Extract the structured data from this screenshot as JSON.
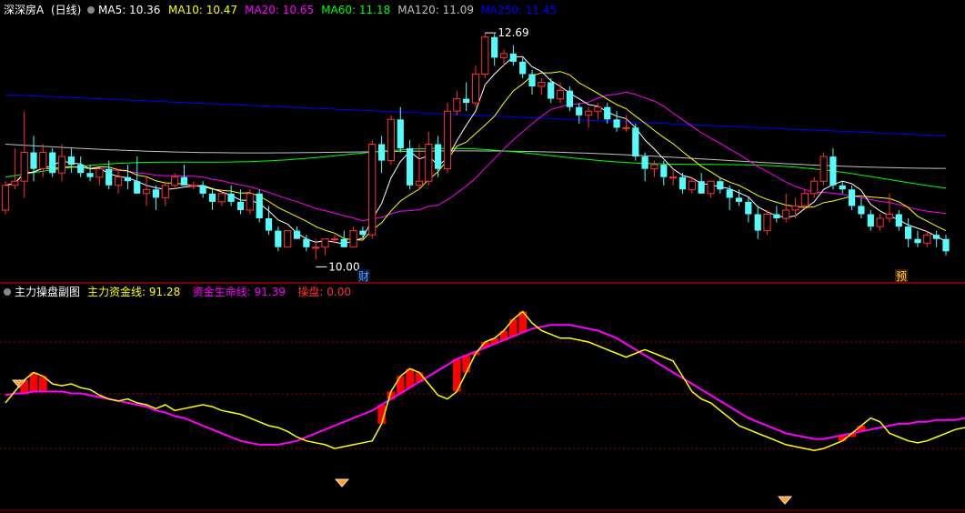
{
  "main_panel": {
    "stock_name": "深深房A",
    "period": "(日线)",
    "ma_labels": [
      {
        "text": "MA5: 10.36",
        "color": "#ffffff"
      },
      {
        "text": "MA10: 10.47",
        "color": "#ffff00"
      },
      {
        "text": "MA20: 10.65",
        "color": "#ff00ff"
      },
      {
        "text": "MA60: 11.18",
        "color": "#00ff00"
      },
      {
        "text": "MA120: 11.09",
        "color": "#c0c0c0"
      },
      {
        "text": "MA250: 11.45",
        "color": "#0000ff"
      }
    ],
    "high_marker": "12.69",
    "low_marker": "10.00",
    "badge_cai": "财",
    "badge_yu": "预"
  },
  "sub_panel": {
    "title": "主力操盘副图",
    "labels": [
      {
        "text": "主力资金线: 91.28",
        "color": "#ffff00"
      },
      {
        "text": "资金生命线: 91.39",
        "color": "#ff00ff"
      },
      {
        "text": "操盘: 0.00",
        "color": "#ff3030"
      }
    ]
  },
  "colors": {
    "up": "#ff3232",
    "down": "#54fcfc",
    "ma5": "#ffffff",
    "ma10": "#ffff00",
    "ma20": "#ff00ff",
    "ma60": "#00ff00",
    "ma120": "#c0c0c0",
    "ma250": "#0000ff",
    "fund_line": "#ffff00",
    "life_line": "#ff00ff",
    "bars": "#ff0000",
    "divider": "#a00000"
  },
  "chart_data": [
    {
      "type": "candlestick",
      "ylim": [
        9.7,
        12.9
      ],
      "candles": [
        {
          "o": 10.55,
          "h": 10.9,
          "l": 10.5,
          "c": 10.85
        },
        {
          "o": 10.85,
          "h": 11.3,
          "l": 10.8,
          "c": 10.9
        },
        {
          "o": 10.9,
          "h": 11.75,
          "l": 10.7,
          "c": 11.25
        },
        {
          "o": 11.25,
          "h": 11.45,
          "l": 10.9,
          "c": 11.05
        },
        {
          "o": 11.05,
          "h": 11.35,
          "l": 10.95,
          "c": 11.25
        },
        {
          "o": 11.25,
          "h": 11.3,
          "l": 10.95,
          "c": 11.0
        },
        {
          "o": 11.0,
          "h": 11.35,
          "l": 10.9,
          "c": 11.2
        },
        {
          "o": 11.2,
          "h": 11.3,
          "l": 11.0,
          "c": 11.1
        },
        {
          "o": 11.1,
          "h": 11.2,
          "l": 10.95,
          "c": 11.0
        },
        {
          "o": 11.0,
          "h": 11.1,
          "l": 10.9,
          "c": 10.95
        },
        {
          "o": 10.95,
          "h": 11.05,
          "l": 10.85,
          "c": 11.05
        },
        {
          "o": 11.05,
          "h": 11.15,
          "l": 10.8,
          "c": 10.85
        },
        {
          "o": 10.85,
          "h": 11.05,
          "l": 10.75,
          "c": 10.95
        },
        {
          "o": 10.95,
          "h": 11.1,
          "l": 10.8,
          "c": 10.9
        },
        {
          "o": 10.9,
          "h": 11.2,
          "l": 10.75,
          "c": 10.75
        },
        {
          "o": 10.75,
          "h": 10.95,
          "l": 10.6,
          "c": 10.8
        },
        {
          "o": 10.8,
          "h": 10.85,
          "l": 10.55,
          "c": 10.7
        },
        {
          "o": 10.7,
          "h": 10.9,
          "l": 10.6,
          "c": 10.85
        },
        {
          "o": 10.85,
          "h": 11.0,
          "l": 10.8,
          "c": 10.95
        },
        {
          "o": 10.95,
          "h": 11.1,
          "l": 10.85,
          "c": 10.85
        },
        {
          "o": 10.85,
          "h": 10.9,
          "l": 10.8,
          "c": 10.85
        },
        {
          "o": 10.85,
          "h": 10.9,
          "l": 10.7,
          "c": 10.75
        },
        {
          "o": 10.75,
          "h": 10.8,
          "l": 10.55,
          "c": 10.65
        },
        {
          "o": 10.65,
          "h": 10.8,
          "l": 10.6,
          "c": 10.75
        },
        {
          "o": 10.75,
          "h": 10.85,
          "l": 10.6,
          "c": 10.65
        },
        {
          "o": 10.65,
          "h": 10.8,
          "l": 10.5,
          "c": 10.55
        },
        {
          "o": 10.55,
          "h": 10.8,
          "l": 10.5,
          "c": 10.75
        },
        {
          "o": 10.75,
          "h": 10.8,
          "l": 10.4,
          "c": 10.45
        },
        {
          "o": 10.45,
          "h": 10.6,
          "l": 10.25,
          "c": 10.3
        },
        {
          "o": 10.3,
          "h": 10.35,
          "l": 10.05,
          "c": 10.1
        },
        {
          "o": 10.1,
          "h": 10.3,
          "l": 10.1,
          "c": 10.3
        },
        {
          "o": 10.3,
          "h": 10.35,
          "l": 10.2,
          "c": 10.2
        },
        {
          "o": 10.2,
          "h": 10.25,
          "l": 10.05,
          "c": 10.1
        },
        {
          "o": 10.1,
          "h": 10.2,
          "l": 9.95,
          "c": 10.1
        },
        {
          "o": 10.1,
          "h": 10.2,
          "l": 10.0,
          "c": 10.2
        },
        {
          "o": 10.2,
          "h": 10.25,
          "l": 10.15,
          "c": 10.2
        },
        {
          "o": 10.2,
          "h": 10.3,
          "l": 10.1,
          "c": 10.1
        },
        {
          "o": 10.1,
          "h": 10.35,
          "l": 10.1,
          "c": 10.3
        },
        {
          "o": 10.3,
          "h": 10.35,
          "l": 10.2,
          "c": 10.25
        },
        {
          "o": 10.25,
          "h": 11.4,
          "l": 10.2,
          "c": 11.35
        },
        {
          "o": 11.35,
          "h": 11.45,
          "l": 11.0,
          "c": 11.15
        },
        {
          "o": 11.15,
          "h": 11.7,
          "l": 11.1,
          "c": 11.65
        },
        {
          "o": 11.65,
          "h": 11.8,
          "l": 11.25,
          "c": 11.3
        },
        {
          "o": 11.3,
          "h": 11.4,
          "l": 10.8,
          "c": 10.85
        },
        {
          "o": 10.85,
          "h": 11.35,
          "l": 10.8,
          "c": 10.9
        },
        {
          "o": 10.9,
          "h": 11.5,
          "l": 10.85,
          "c": 11.35
        },
        {
          "o": 11.35,
          "h": 11.45,
          "l": 10.95,
          "c": 11.05
        },
        {
          "o": 11.05,
          "h": 11.85,
          "l": 11.0,
          "c": 11.75
        },
        {
          "o": 11.75,
          "h": 12.0,
          "l": 11.7,
          "c": 11.9
        },
        {
          "o": 11.9,
          "h": 12.1,
          "l": 11.75,
          "c": 11.85
        },
        {
          "o": 11.85,
          "h": 12.3,
          "l": 11.8,
          "c": 12.2
        },
        {
          "o": 12.2,
          "h": 12.7,
          "l": 12.15,
          "c": 12.65
        },
        {
          "o": 12.65,
          "h": 12.69,
          "l": 12.3,
          "c": 12.4
        },
        {
          "o": 12.4,
          "h": 12.5,
          "l": 12.3,
          "c": 12.45
        },
        {
          "o": 12.45,
          "h": 12.55,
          "l": 12.3,
          "c": 12.35
        },
        {
          "o": 12.35,
          "h": 12.4,
          "l": 12.15,
          "c": 12.2
        },
        {
          "o": 12.2,
          "h": 12.25,
          "l": 11.95,
          "c": 12.05
        },
        {
          "o": 12.05,
          "h": 12.15,
          "l": 11.95,
          "c": 12.1
        },
        {
          "o": 12.1,
          "h": 12.15,
          "l": 11.85,
          "c": 11.9
        },
        {
          "o": 11.9,
          "h": 12.1,
          "l": 11.85,
          "c": 12.0
        },
        {
          "o": 12.0,
          "h": 12.05,
          "l": 11.75,
          "c": 11.8
        },
        {
          "o": 11.8,
          "h": 11.85,
          "l": 11.6,
          "c": 11.7
        },
        {
          "o": 11.7,
          "h": 11.8,
          "l": 11.55,
          "c": 11.75
        },
        {
          "o": 11.75,
          "h": 11.85,
          "l": 11.65,
          "c": 11.8
        },
        {
          "o": 11.8,
          "h": 11.85,
          "l": 11.6,
          "c": 11.65
        },
        {
          "o": 11.65,
          "h": 11.75,
          "l": 11.5,
          "c": 11.55
        },
        {
          "o": 11.55,
          "h": 11.7,
          "l": 11.5,
          "c": 11.55
        },
        {
          "o": 11.55,
          "h": 11.6,
          "l": 11.15,
          "c": 11.2
        },
        {
          "o": 11.2,
          "h": 11.25,
          "l": 10.9,
          "c": 11.05
        },
        {
          "o": 11.05,
          "h": 11.15,
          "l": 10.95,
          "c": 11.1
        },
        {
          "o": 11.1,
          "h": 11.15,
          "l": 10.85,
          "c": 10.95
        },
        {
          "o": 10.95,
          "h": 11.05,
          "l": 10.85,
          "c": 10.95
        },
        {
          "o": 10.95,
          "h": 11.0,
          "l": 10.75,
          "c": 10.8
        },
        {
          "o": 10.8,
          "h": 10.95,
          "l": 10.75,
          "c": 10.9
        },
        {
          "o": 10.9,
          "h": 11.0,
          "l": 10.75,
          "c": 10.75
        },
        {
          "o": 10.75,
          "h": 10.9,
          "l": 10.7,
          "c": 10.9
        },
        {
          "o": 10.9,
          "h": 10.95,
          "l": 10.75,
          "c": 10.8
        },
        {
          "o": 10.8,
          "h": 10.85,
          "l": 10.55,
          "c": 10.7
        },
        {
          "o": 10.7,
          "h": 10.8,
          "l": 10.6,
          "c": 10.65
        },
        {
          "o": 10.65,
          "h": 10.7,
          "l": 10.4,
          "c": 10.5
        },
        {
          "o": 10.5,
          "h": 10.6,
          "l": 10.2,
          "c": 10.3
        },
        {
          "o": 10.3,
          "h": 10.55,
          "l": 10.25,
          "c": 10.5
        },
        {
          "o": 10.5,
          "h": 10.6,
          "l": 10.4,
          "c": 10.45
        },
        {
          "o": 10.45,
          "h": 10.75,
          "l": 10.4,
          "c": 10.55
        },
        {
          "o": 10.55,
          "h": 10.7,
          "l": 10.45,
          "c": 10.6
        },
        {
          "o": 10.6,
          "h": 10.8,
          "l": 10.55,
          "c": 10.75
        },
        {
          "o": 10.75,
          "h": 10.95,
          "l": 10.7,
          "c": 10.9
        },
        {
          "o": 10.9,
          "h": 11.25,
          "l": 10.85,
          "c": 11.2
        },
        {
          "o": 11.2,
          "h": 11.3,
          "l": 10.8,
          "c": 10.85
        },
        {
          "o": 10.85,
          "h": 10.9,
          "l": 10.75,
          "c": 10.8
        },
        {
          "o": 10.8,
          "h": 10.85,
          "l": 10.55,
          "c": 10.6
        },
        {
          "o": 10.6,
          "h": 10.7,
          "l": 10.45,
          "c": 10.5
        },
        {
          "o": 10.5,
          "h": 10.55,
          "l": 10.3,
          "c": 10.35
        },
        {
          "o": 10.35,
          "h": 10.5,
          "l": 10.3,
          "c": 10.45
        },
        {
          "o": 10.45,
          "h": 10.75,
          "l": 10.4,
          "c": 10.5
        },
        {
          "o": 10.5,
          "h": 10.55,
          "l": 10.3,
          "c": 10.35
        },
        {
          "o": 10.35,
          "h": 10.45,
          "l": 10.1,
          "c": 10.2
        },
        {
          "o": 10.2,
          "h": 10.3,
          "l": 10.1,
          "c": 10.15
        },
        {
          "o": 10.15,
          "h": 10.3,
          "l": 10.1,
          "c": 10.25
        },
        {
          "o": 10.25,
          "h": 10.3,
          "l": 10.1,
          "c": 10.2
        },
        {
          "o": 10.2,
          "h": 10.25,
          "l": 10.0,
          "c": 10.05
        }
      ]
    },
    {
      "type": "line",
      "title": "主力操盘副图",
      "ylim": [
        0,
        110
      ],
      "series": [
        {
          "name": "主力资金线",
          "values": [
            56,
            62,
            68,
            72,
            70,
            66,
            65,
            66,
            64,
            63,
            60,
            58,
            57,
            58,
            56,
            55,
            53,
            55,
            52,
            53,
            54,
            55,
            54,
            52,
            51,
            50,
            48,
            46,
            44,
            43,
            41,
            38,
            36,
            35,
            34,
            32,
            33,
            34,
            35,
            36,
            45,
            62,
            70,
            74,
            72,
            66,
            60,
            58,
            62,
            72,
            82,
            88,
            90,
            94,
            100,
            104,
            98,
            94,
            92,
            90,
            90,
            89,
            88,
            86,
            84,
            82,
            80,
            82,
            84,
            82,
            80,
            78,
            70,
            62,
            58,
            56,
            52,
            48,
            44,
            42,
            40,
            38,
            36,
            34,
            33,
            32,
            31,
            32,
            34,
            36,
            40,
            44,
            48,
            46,
            40,
            38,
            36,
            35,
            36,
            38,
            40,
            42,
            43,
            44,
            42,
            40
          ]
        },
        {
          "name": "资金生命线",
          "values": [
            60,
            61,
            61,
            62,
            62,
            62,
            62,
            61,
            61,
            60,
            59,
            58,
            57,
            56,
            55,
            54,
            52,
            51,
            49,
            48,
            46,
            44,
            42,
            40,
            38,
            36,
            35,
            34,
            34,
            34,
            35,
            36,
            38,
            40,
            42,
            44,
            46,
            48,
            50,
            52,
            55,
            58,
            61,
            64,
            67,
            70,
            73,
            76,
            79,
            81,
            83,
            85,
            87,
            89,
            91,
            93,
            95,
            96,
            97,
            97,
            97,
            96,
            95,
            94,
            92,
            90,
            87,
            84,
            81,
            78,
            75,
            72,
            69,
            66,
            63,
            60,
            57,
            54,
            51,
            48,
            46,
            44,
            42,
            40,
            39,
            38,
            37,
            37,
            38,
            39,
            40,
            41,
            42,
            43,
            44,
            45,
            45,
            46,
            46,
            47,
            47,
            47,
            48,
            48,
            48,
            47
          ]
        },
        {
          "name": "操盘",
          "values": [
            0,
            0,
            1,
            1,
            1,
            0,
            0,
            0,
            0,
            0,
            0,
            0,
            0,
            0,
            0,
            0,
            0,
            0,
            0,
            0,
            0,
            0,
            0,
            0,
            0,
            0,
            0,
            0,
            0,
            0,
            0,
            0,
            0,
            0,
            0,
            0,
            0,
            0,
            0,
            0,
            1,
            1,
            1,
            1,
            1,
            0,
            0,
            0,
            1,
            1,
            1,
            1,
            1,
            1,
            1,
            1,
            0,
            0,
            0,
            0,
            0,
            0,
            0,
            0,
            0,
            0,
            0,
            0,
            0,
            0,
            0,
            0,
            0,
            0,
            0,
            0,
            0,
            0,
            0,
            0,
            0,
            0,
            0,
            0,
            0,
            0,
            0,
            0,
            0,
            1,
            1,
            1,
            0,
            0,
            0,
            0,
            0,
            0,
            0,
            0,
            0,
            0,
            0,
            0,
            0,
            0
          ]
        }
      ]
    }
  ]
}
